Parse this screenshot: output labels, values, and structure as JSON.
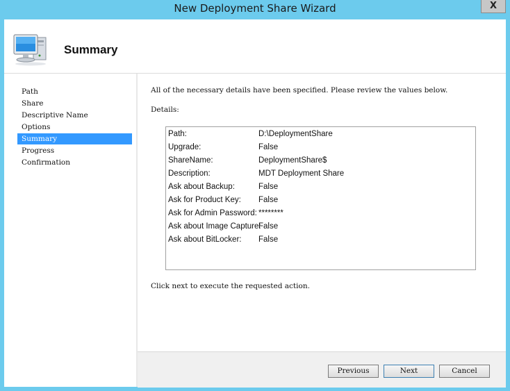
{
  "window": {
    "title": "New Deployment Share Wizard",
    "close_glyph": "X"
  },
  "header": {
    "icon": "computer-monitor-icon",
    "title": "Summary"
  },
  "sidebar": {
    "items": [
      {
        "label": "Path",
        "active": false
      },
      {
        "label": "Share",
        "active": false
      },
      {
        "label": "Descriptive Name",
        "active": false
      },
      {
        "label": "Options",
        "active": false
      },
      {
        "label": "Summary",
        "active": true
      },
      {
        "label": "Progress",
        "active": false
      },
      {
        "label": "Confirmation",
        "active": false
      }
    ]
  },
  "main": {
    "intro": "All of the necessary details have been specified.  Please review the values below.",
    "details_label": "Details:",
    "details": [
      {
        "key": "Path:",
        "value": "D:\\DeploymentShare"
      },
      {
        "key": "Upgrade:",
        "value": "False"
      },
      {
        "key": "ShareName:",
        "value": "DeploymentShare$"
      },
      {
        "key": "Description:",
        "value": "MDT Deployment Share"
      },
      {
        "key": "Ask about Backup:",
        "value": "False"
      },
      {
        "key": "Ask for Product Key:",
        "value": "False"
      },
      {
        "key": "Ask for Admin Password:",
        "value": "********"
      },
      {
        "key": "Ask about Image Capture:",
        "value": "False"
      },
      {
        "key": "Ask about BitLocker:",
        "value": "False"
      }
    ],
    "footer_note": "Click next to execute the requested action."
  },
  "buttons": {
    "previous": "Previous",
    "next": "Next",
    "cancel": "Cancel"
  },
  "colors": {
    "window_frame": "#6ccbed",
    "selection": "#3399ff"
  }
}
